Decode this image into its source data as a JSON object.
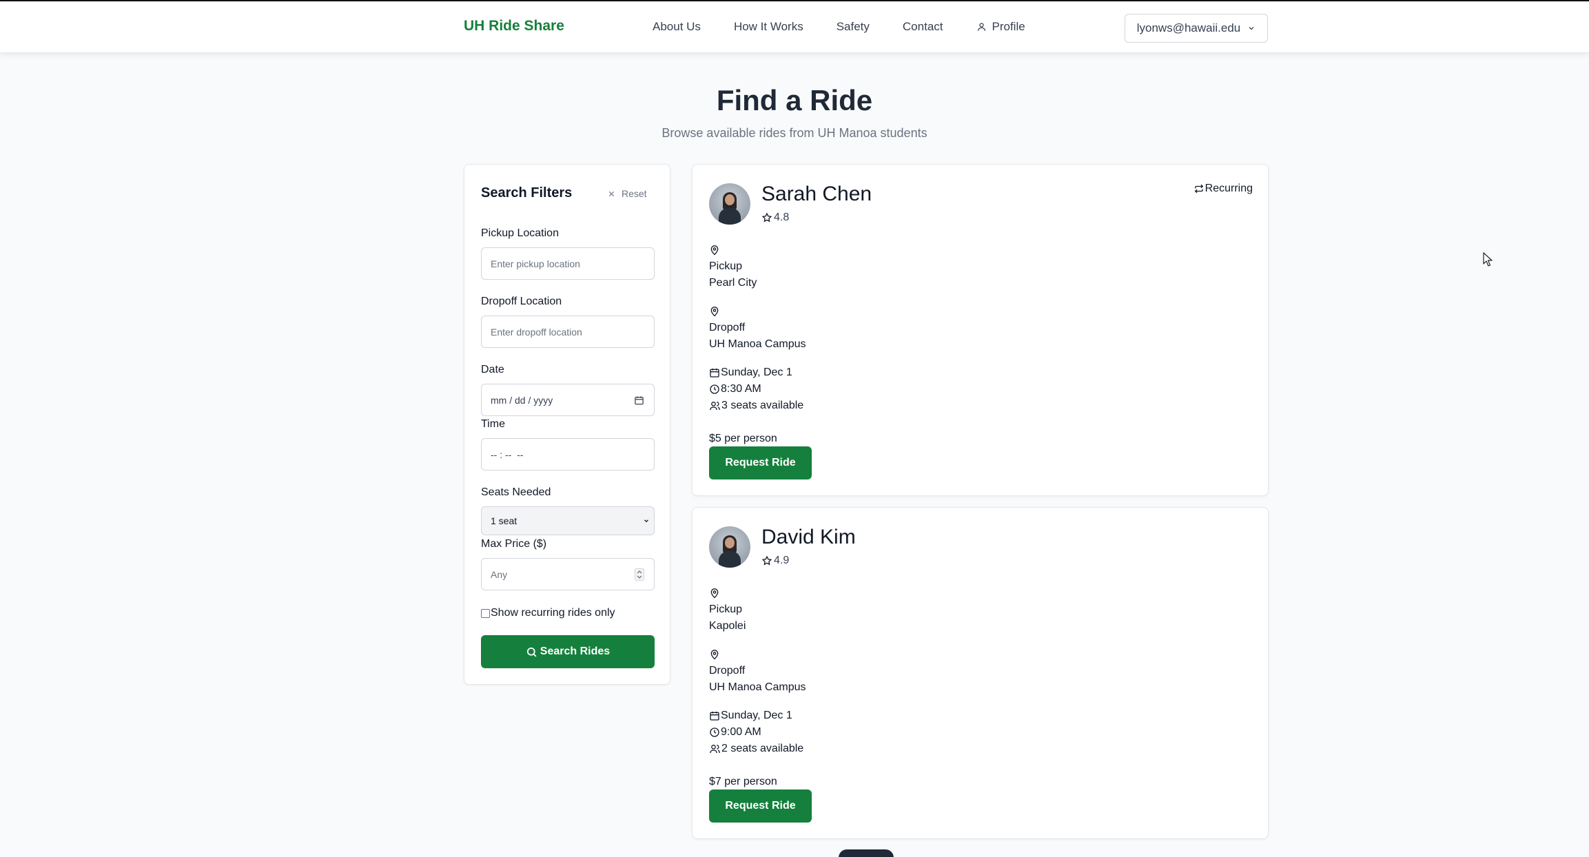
{
  "nav": {
    "brand": "UH Ride Share",
    "links": [
      "About Us",
      "How It Works",
      "Safety",
      "Contact"
    ],
    "profile": "Profile",
    "user_email": "lyonws@hawaii.edu"
  },
  "header": {
    "title": "Find a Ride",
    "subtitle": "Browse available rides from UH Manoa students"
  },
  "filters": {
    "title": "Search Filters",
    "reset": "Reset",
    "pickup_label": "Pickup Location",
    "pickup_placeholder": "Enter pickup location",
    "dropoff_label": "Dropoff Location",
    "dropoff_placeholder": "Enter dropoff location",
    "date_label": "Date",
    "date_placeholder": "mm / dd / yyyy",
    "time_label": "Time",
    "time_placeholder": "-- : --  --",
    "seats_label": "Seats Needed",
    "seats_value": "1 seat",
    "max_price_label": "Max Price ($)",
    "max_price_placeholder": "Any",
    "recurring_only_label": "Show recurring rides only",
    "search_button": "Search Rides"
  },
  "rides": [
    {
      "driver": "Sarah Chen",
      "rating": "4.8",
      "badge": "Recurring",
      "pickup_label": "Pickup",
      "pickup": "Pearl City",
      "dropoff_label": "Dropoff",
      "dropoff": "UH Manoa Campus",
      "date": "Sunday, Dec 1",
      "time": "8:30 AM",
      "seats": "3 seats available",
      "price": "$5 per person",
      "button": "Request Ride"
    },
    {
      "driver": "David Kim",
      "rating": "4.9",
      "pickup_label": "Pickup",
      "pickup": "Kapolei",
      "dropoff_label": "Dropoff",
      "dropoff": "UH Manoa Campus",
      "date": "Sunday, Dec 1",
      "time": "9:00 AM",
      "seats": "2 seats available",
      "price": "$7 per person",
      "button": "Request Ride"
    }
  ],
  "colors": {
    "brand_green": "#15803d",
    "page_bg": "#f9fafb",
    "text_muted": "#6b7280"
  }
}
